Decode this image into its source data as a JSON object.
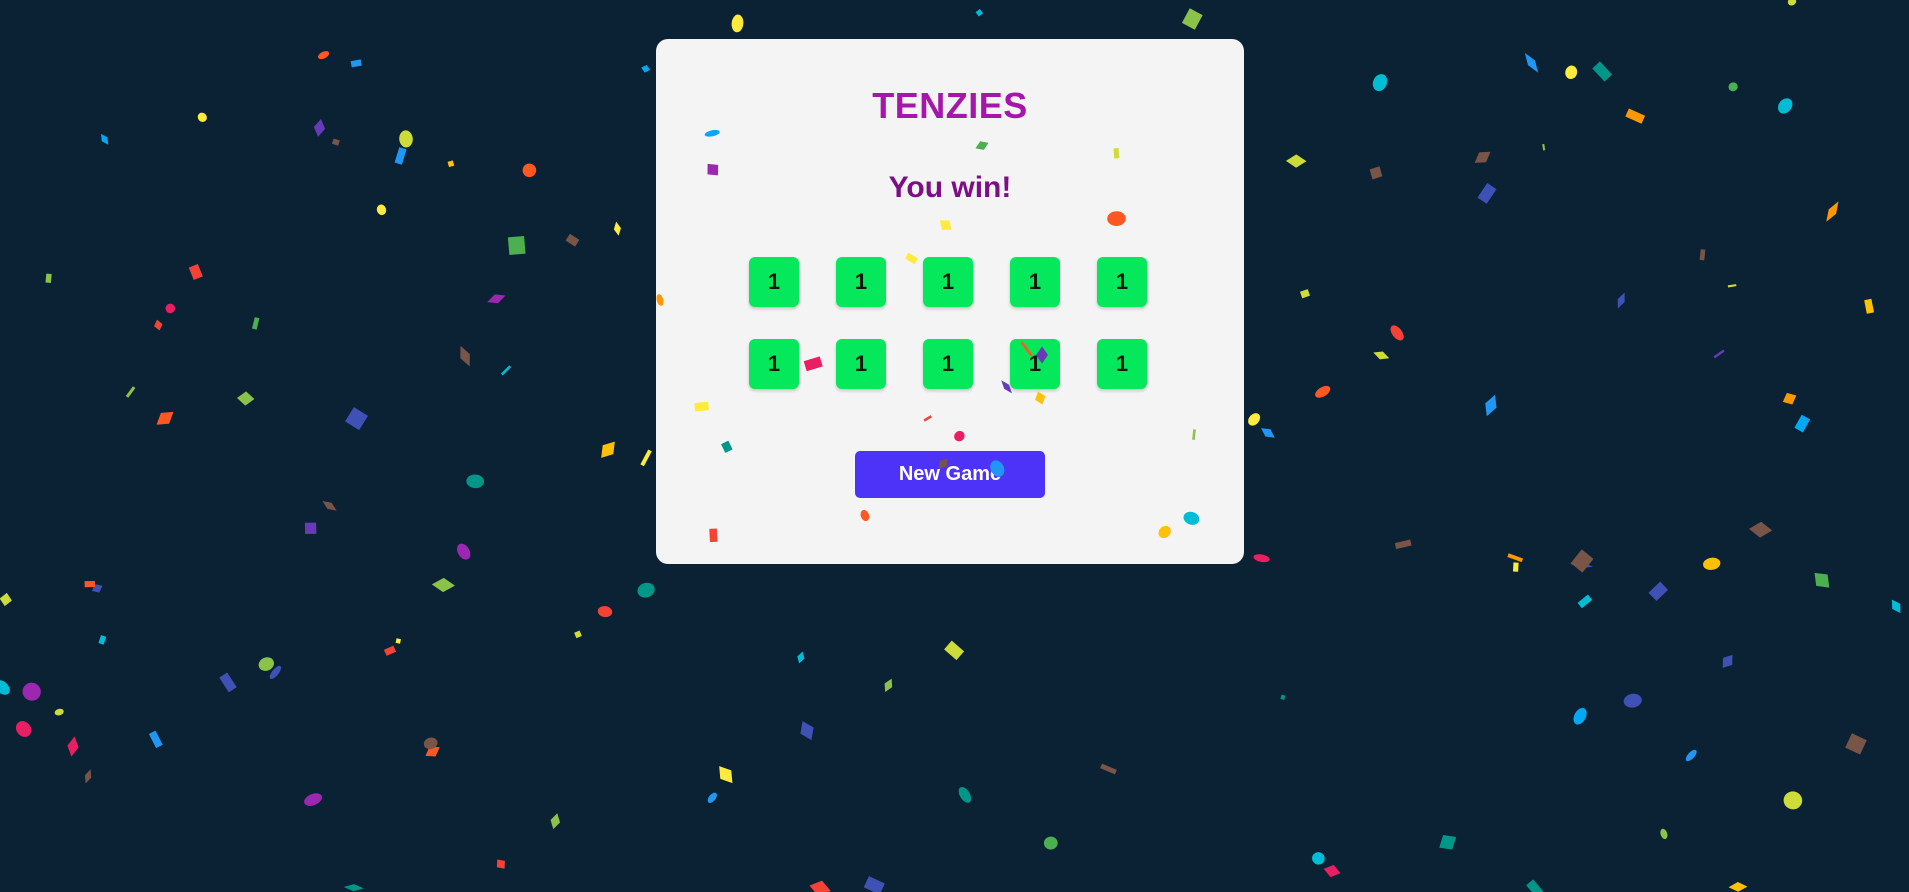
{
  "game": {
    "title": "TENZIES",
    "status": "You win!",
    "dice": [
      "1",
      "1",
      "1",
      "1",
      "1",
      "1",
      "1",
      "1",
      "1",
      "1"
    ],
    "new_game_label": "New Game"
  },
  "colors": {
    "background": "#0b2234",
    "card": "#f4f4f4",
    "title": "#a517a8",
    "status": "#7c0f85",
    "die_held": "#05e85b",
    "button": "#4d33f7",
    "confetti": [
      "#f44336",
      "#e91e63",
      "#9c27b0",
      "#673ab7",
      "#3f51b5",
      "#2196f3",
      "#03a9f4",
      "#00bcd4",
      "#009688",
      "#4caf50",
      "#8bc34a",
      "#cddc39",
      "#ffeb3b",
      "#ffc107",
      "#ff9800",
      "#ff5722",
      "#795548"
    ]
  }
}
